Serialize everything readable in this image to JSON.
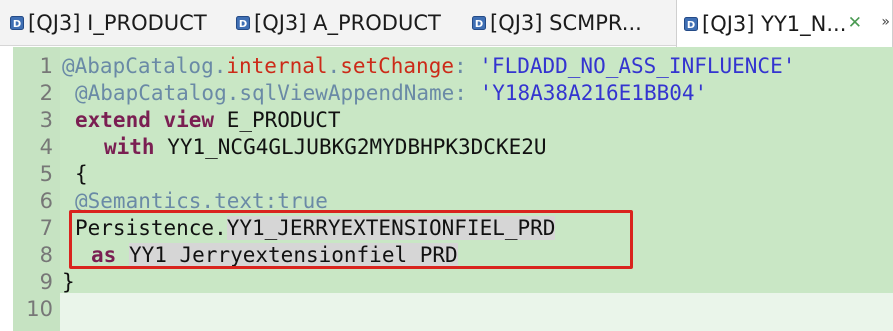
{
  "tabs": [
    {
      "label": "[QJ3] I_PRODUCT",
      "active": false
    },
    {
      "label": "[QJ3] A_PRODUCT",
      "active": false
    },
    {
      "label": "[QJ3] SCMPR...",
      "active": false
    },
    {
      "label": "[QJ3] YY1_N...",
      "active": true
    }
  ],
  "tab_icon": "ddl-source-icon",
  "close_glyph": "✕",
  "overflow_glyph": "»",
  "line_numbers": [
    "1",
    "2",
    "3",
    "4",
    "5",
    "6",
    "7",
    "8",
    "9",
    "10"
  ],
  "code": {
    "l1": {
      "at": "@AbapCatalog.",
      "internal": "internal",
      "dot": ".",
      "setChange": "setChange",
      "colon": ": ",
      "value": "'FLDADD_NO_ASS_INFLUENCE'"
    },
    "l2": {
      "anno": "@AbapCatalog.sqlViewAppendName: ",
      "value": "'Y18A38A216E1BB04'"
    },
    "l3": {
      "kw": "extend view",
      "rest": " E_PRODUCT"
    },
    "l4": {
      "kw": "with",
      "rest": " YY1_NCG4GLJUBKG2MYDBHPK3DCKE2U"
    },
    "l5": {
      "text": "{"
    },
    "l6": {
      "anno": "@Semantics.text:true"
    },
    "l7": {
      "prefix": "Persistence.",
      "field": "YY1_JERRYEXTENSIONFIEL_PRD"
    },
    "l8": {
      "kw": "as",
      "alias": "YY1_Jerryextensionfiel_PRD"
    },
    "l9": {
      "text": "}"
    }
  },
  "colors": {
    "code_background": "#c9e7c5",
    "highlight_box": "#d9241e",
    "keyword": "#7a1f52",
    "string": "#3434d0"
  }
}
